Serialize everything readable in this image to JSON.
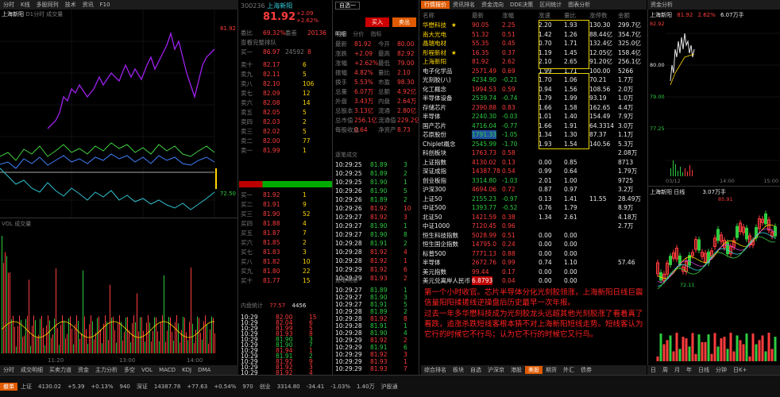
{
  "topbar": {
    "left_tabs": [
      "分时",
      "K线",
      "多股同列",
      "技术",
      "资讯",
      "F10"
    ],
    "right_tabs": [
      "行情报价",
      "资讯排名",
      "资金流向",
      "DDE决策",
      "区间统计",
      "图表分析",
      "资金分析"
    ],
    "quote_title": "上海新阳"
  },
  "chart1": {
    "name": "上海新阳",
    "legend": "D1分时 成交量",
    "y_labels": [
      "81.92",
      "",
      "",
      "",
      "",
      "",
      "",
      "72.50"
    ]
  },
  "chart2": {
    "legend": "VOL 成交量",
    "labels": [
      "11:20",
      "13:00",
      "14:00"
    ]
  },
  "left_bottom_tabs": [
    "分时",
    "成交明细",
    "买卖力道",
    "资金",
    "主力分析",
    "多空",
    "VOL",
    "MACD",
    "KDJ",
    "DMA"
  ],
  "quote": {
    "code": "300236",
    "name": "上海新阳",
    "price": "81.92",
    "change": "+2.09",
    "pct": "+2.62%",
    "sel_label": "自选一",
    "buy_label": "买入",
    "sell_label": "卖出",
    "info": [
      [
        "涨跌",
        "+2.09",
        "涨幅",
        "+2.62%"
      ],
      [
        "均价",
        "81.19",
        "换手",
        "5.53%"
      ],
      [
        "今开",
        "80.00",
        "最高",
        "82.92"
      ],
      [
        "总量",
        "60657",
        "现手",
        "16"
      ],
      [
        "外盘",
        "34267",
        "内盘",
        "26390"
      ],
      [
        "量比",
        "2.10%",
        "委比",
        "-0.63"
      ]
    ],
    "tabs": [
      "明细",
      "分价",
      "指标"
    ],
    "side": [
      [
        "委比",
        "69.32%",
        "委差",
        "20136"
      ],
      [
        "查看完整排队"
      ],
      [
        "买一",
        "86.97",
        "24592",
        "8"
      ]
    ],
    "levels": [
      [
        "卖十",
        "82.17",
        "6"
      ],
      [
        "卖九",
        "82.11",
        "5"
      ],
      [
        "卖八",
        "82.10",
        "106"
      ],
      [
        "卖七",
        "82.09",
        "12"
      ],
      [
        "卖六",
        "82.08",
        "14"
      ],
      [
        "卖五",
        "82.05",
        "5"
      ],
      [
        "卖四",
        "82.03",
        "2"
      ],
      [
        "卖三",
        "82.02",
        "5"
      ],
      [
        "卖二",
        "82.00",
        "77"
      ],
      [
        "卖一",
        "81.99",
        "1"
      ],
      [
        "买一",
        "81.92",
        "1"
      ],
      [
        "买二",
        "81.91",
        "9"
      ],
      [
        "买三",
        "81.90",
        "52"
      ],
      [
        "买四",
        "81.88",
        "4"
      ],
      [
        "买五",
        "81.87",
        "7"
      ],
      [
        "买六",
        "81.85",
        "2"
      ],
      [
        "买七",
        "81.83",
        "3"
      ],
      [
        "买八",
        "81.82",
        "10"
      ],
      [
        "买九",
        "81.80",
        "22"
      ],
      [
        "买十",
        "81.77",
        "15"
      ]
    ],
    "stats": [
      [
        "最新",
        "81.92",
        "今开",
        "80.00"
      ],
      [
        "涨跌",
        "+2.09",
        "最高",
        "82.92"
      ],
      [
        "涨幅",
        "+2.62%",
        "最低",
        "79.00"
      ],
      [
        "振幅",
        "4.82%",
        "量比",
        "2.10"
      ],
      [
        "换手",
        "5.53%",
        "市盈",
        "98.30"
      ],
      [
        "总量",
        "6.07万",
        "总额",
        "4.92亿"
      ],
      [
        "外盘",
        "3.43万",
        "内盘",
        "2.64万"
      ],
      [
        "总股本",
        "3.13亿",
        "流通",
        "2.80亿"
      ],
      [
        "总市值",
        "256.1亿",
        "流通值",
        "229.2亿"
      ],
      [
        "每股收益",
        "0.64",
        "净资产",
        "8.73"
      ]
    ],
    "bottom_left": "内盘统计",
    "bottom_vals": [
      "77.57",
      "4456"
    ]
  },
  "ticks": {
    "header": "逐笔成交",
    "rows": [
      [
        "10:29:25",
        "81.89",
        "3"
      ],
      [
        "10:29:25",
        "81.89",
        "2"
      ],
      [
        "10:29:25",
        "81.90",
        "1"
      ],
      [
        "10:29:26",
        "81.90",
        "5"
      ],
      [
        "10:29:26",
        "81.89",
        "2"
      ],
      [
        "10:29:26",
        "81.92",
        "10"
      ],
      [
        "10:29:27",
        "81.92",
        "3"
      ],
      [
        "10:29:27",
        "81.90",
        "1"
      ],
      [
        "10:29:27",
        "81.90",
        "8"
      ],
      [
        "10:29:28",
        "81.91",
        "2"
      ],
      [
        "10:29:28",
        "81.92",
        "4"
      ],
      [
        "10:29:28",
        "81.92",
        "1"
      ],
      [
        "10:29:29",
        "81.92",
        "6"
      ],
      [
        "10:29:29",
        "81.93",
        "2"
      ]
    ]
  },
  "ticks2": {
    "header": "逐笔明细",
    "rows": [
      [
        "10:29:27",
        "81.89",
        "1"
      ],
      [
        "10:29:27",
        "81.90",
        "3"
      ],
      [
        "10:29:27",
        "81.91",
        "5"
      ],
      [
        "10:29:28",
        "81.89",
        "2"
      ],
      [
        "10:29:28",
        "81.92",
        "8"
      ],
      [
        "10:29:28",
        "81.91",
        "1"
      ],
      [
        "10:29:28",
        "81.90",
        "4"
      ],
      [
        "10:29:29",
        "81.92",
        "2"
      ],
      [
        "10:29:29",
        "81.91",
        "6"
      ],
      [
        "10:29:29",
        "81.92",
        "3"
      ],
      [
        "10:29:29",
        "81.93",
        "1"
      ],
      [
        "10:29:29",
        "81.93",
        "7"
      ]
    ]
  },
  "ticks3": {
    "header": "成交明细",
    "rows": [
      [
        "10:29",
        "82.00",
        "15"
      ],
      [
        "10:29",
        "82.04",
        "6"
      ],
      [
        "10:29",
        "81.99",
        "5"
      ],
      [
        "10:29",
        "81.93",
        "8"
      ],
      [
        "10:29",
        "81.90",
        "3"
      ],
      [
        "10:29",
        "81.90",
        "7"
      ],
      [
        "10:29",
        "81.94",
        "1"
      ],
      [
        "10:29",
        "81.91",
        "2"
      ],
      [
        "10:29",
        "81.92",
        "9"
      ],
      [
        "10:29",
        "81.92",
        "3"
      ],
      [
        "10:29",
        "81.92",
        "4"
      ]
    ]
  },
  "sectors": {
    "headers": [
      "名称",
      "",
      "最新",
      "涨幅",
      "涨速",
      "量比",
      "涨停数",
      "金额"
    ],
    "rows": [
      [
        "华懋科技",
        "★",
        "90.05",
        "2.25",
        "2.20",
        "1.93",
        "130.30",
        "299.7亿"
      ],
      [
        "南大光电",
        "",
        "51.32",
        "0.51",
        "1.42",
        "1.26",
        "88.44亿",
        "354.7亿"
      ],
      [
        "晶瑞电材",
        "",
        "55.35",
        "0.45",
        "0.70",
        "1.71",
        "132.4亿",
        "325.0亿"
      ],
      [
        "彤程新材",
        "★",
        "16.35",
        "0.37",
        "1.19",
        "1.45",
        "12.05亿",
        "158.4亿"
      ],
      [
        "上海新阳",
        "",
        "81.92",
        "2.62",
        "2.10",
        "2.65",
        "91.20亿",
        "256.1亿"
      ],
      [
        "电子化学品",
        "",
        "2571.49",
        "0.69",
        "1.99",
        "1.71",
        "100.00",
        "5266"
      ],
      [
        "光刻胶(八)",
        "",
        "4234.90",
        "-0.21",
        "1.70",
        "1.06",
        "70.21",
        "1.7万"
      ],
      [
        "化工概念",
        "",
        "1994.53",
        "0.59",
        "0.94",
        "1.56",
        "108.56",
        "2.0万"
      ],
      [
        "半导体设备",
        "",
        "2539.74",
        "-0.74",
        "1.79",
        "1.99",
        "93.19",
        "1.0万"
      ],
      [
        "存储芯片",
        "",
        "2390.88",
        "0.83",
        "1.66",
        "1.58",
        "162.65",
        "4.4万"
      ],
      [
        "半导体",
        "",
        "2240.30",
        "-0.03",
        "1.01",
        "1.40",
        "154.49",
        "7.9万"
      ],
      [
        "国产芯片",
        "",
        "4716.04",
        "-0.77",
        "1.66",
        "1.91",
        "64.3314",
        "3.0万"
      ],
      [
        "芯原股份",
        "",
        "1791.33",
        "-1.05",
        "1.34",
        "1.30",
        "87.37",
        "1.1万"
      ],
      [
        "Chiplet概念",
        "",
        "2545.99",
        "-1.70",
        "1.93",
        "1.54",
        "140.56",
        "5.3万"
      ],
      [
        "科创板块",
        "",
        "1763.73",
        "0.58",
        "",
        "",
        "",
        "2.08万"
      ],
      [
        "上证指数",
        "",
        "4130.02",
        "0.13",
        "0.00",
        "0.85",
        "",
        "8713"
      ],
      [
        "深证成指",
        "",
        "14387.78",
        "0.54",
        "0.99",
        "0.64",
        "",
        "1.79万"
      ],
      [
        "创业板指",
        "",
        "3314.80",
        "-1.03",
        "2.01",
        "1.00",
        "",
        "9725"
      ],
      [
        "沪深300",
        "",
        "4694.06",
        "0.72",
        "0.87",
        "0.97",
        "",
        "3.2万"
      ],
      [
        "上证50",
        "",
        "2155.23",
        "-0.97",
        "0.13",
        "1.41",
        "11.55",
        "28.49万"
      ],
      [
        "中证500",
        "",
        "1393.77",
        "-0.52",
        "0.76",
        "1.79",
        "",
        "8.9万"
      ],
      [
        "北证50",
        "",
        "1421.59",
        "0.38",
        "1.34",
        "2.61",
        "",
        "4.18万"
      ],
      [
        "中证1000",
        "",
        "7120.45",
        "0.96",
        "",
        "",
        "",
        "2.7万"
      ],
      [
        "恒生科技指数",
        "",
        "5028.99",
        "0.51",
        "0.00",
        "0.00",
        "",
        ""
      ],
      [
        "恒生国企指数",
        "",
        "14795.0",
        "0.24",
        "0.00",
        "0.00",
        "",
        ""
      ],
      [
        "标普500",
        "",
        "7771.13",
        "0.88",
        "0.00",
        "0.00",
        "",
        ""
      ],
      [
        "半导体",
        "",
        "2672.76",
        "0.99",
        "0.74",
        "1.10",
        "",
        "57.46"
      ],
      [
        "美元指数",
        "",
        "99.44",
        "0.17",
        "0.00",
        "0.00",
        "",
        ""
      ],
      [
        "美元兑离岸人民币",
        "",
        "6.8793",
        "0.04",
        "0.00",
        "0.00",
        "",
        ""
      ]
    ]
  },
  "comment": {
    "p1": "第一个小时收官。芯片半导体分化光刻胶领涨，上海新阳日线巨震信量阳阳揉搓线逆操盘后历史最早一次年报。",
    "p2": "过去一年多华懋科技成为光刻胶龙头远超其他光刻胶涨了看着真了看跌，追涨杀跌短线客根本猜不对上海新阳短线走势。短线客认为它行的时候它不行鸟；认为它不行的时候它又行鸟。"
  },
  "right_charts": {
    "top_title": "上海新阳",
    "top_price": "81.92",
    "top_pct": "2.62%",
    "top_vol": "6.07万手",
    "top_y": [
      "82.92",
      "80.00",
      "79.00",
      "77.25"
    ],
    "top_x": [
      "03/12",
      "14:00",
      "15:00"
    ],
    "k_title": "上海新阳 日线",
    "k_high": "85.91",
    "k_low": "72.11",
    "k_vol": "3.07万手"
  },
  "mid_tabs": [
    "综合排名",
    "板块",
    "自选",
    "沪深京",
    "港股",
    "美股",
    "期货",
    "外汇",
    "债券"
  ],
  "right_bottom_tabs": [
    "日",
    "周",
    "月",
    "年",
    "日线",
    "分钟",
    "日K+"
  ],
  "statusbar": {
    "items": [
      [
        "上证",
        "4130.02",
        "+5.39",
        "+0.13%",
        "940"
      ],
      [
        "深证",
        "14387.78",
        "+77.63",
        "+0.54%",
        "970"
      ],
      [
        "创业",
        "3314.80",
        "-34.41",
        "-1.03%",
        "1.40万"
      ]
    ],
    "left_btn": "撤单",
    "right_text": "沪股通"
  },
  "colors": {
    "up": "#ff3c3c",
    "down": "#2ecc40",
    "bg": "#000000",
    "accent": "#e05a00",
    "highlight": "#e8d000"
  }
}
